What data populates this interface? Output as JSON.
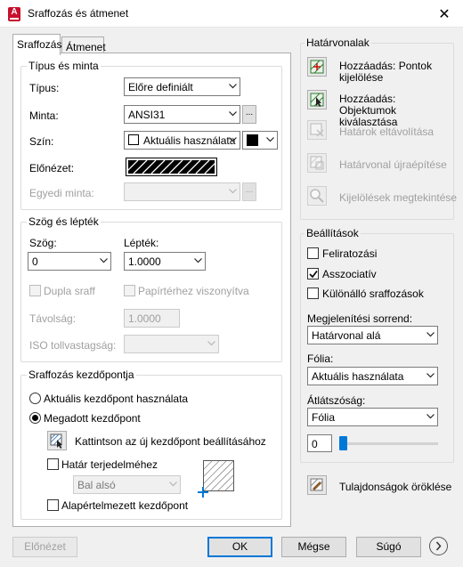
{
  "window": {
    "title": "Sraffozás és átmenet",
    "close_glyph": "✕"
  },
  "tabs": [
    {
      "label": "Sraffozás"
    },
    {
      "label": "Átmenet"
    }
  ],
  "type_pattern": {
    "group_title": "Típus és minta",
    "type_label": "Típus:",
    "type_value": "Előre definiált",
    "pattern_label": "Minta:",
    "pattern_value": "ANSI31",
    "color_label": "Szín:",
    "color_value": "Aktuális használata",
    "preview_label": "Előnézet:",
    "custom_label": "Egyedi minta:",
    "ellipsis": "..."
  },
  "angle_scale": {
    "group_title": "Szög és lépték",
    "angle_label": "Szög:",
    "angle_value": "0",
    "scale_label": "Lépték:",
    "scale_value": "1.0000",
    "double_label": "Dupla sraff",
    "paper_label": "Papírtérhez viszonyítva",
    "spacing_label": "Távolság:",
    "spacing_value": "1.0000",
    "iso_label": "ISO tollvastagság:"
  },
  "origin": {
    "group_title": "Sraffozás kezdőpontja",
    "current_label": "Aktuális kezdőpont használata",
    "specified_label": "Megadott kezdőpont",
    "click_label": "Kattintson az új kezdőpont beállításához",
    "extent_label": "Határ terjedelméhez",
    "extent_value": "Bal alsó",
    "default_label": "Alapértelmezett kezdőpont"
  },
  "boundaries": {
    "group_title": "Határvonalak",
    "add_points": "Hozzáadás: Pontok kijelölése",
    "add_objects": "Hozzáadás: Objektumok kiválasztása",
    "remove": "Határok eltávolítása",
    "recreate": "Határvonal újraépítése",
    "view": "Kijelölések megtekintése"
  },
  "options": {
    "group_title": "Beállítások",
    "annotative": "Feliratozási",
    "associative": "Asszociatív",
    "separate": "Különálló sraffozások",
    "draw_order_label": "Megjelenítési sorrend:",
    "draw_order_value": "Határvonal alá",
    "layer_label": "Fólia:",
    "layer_value": "Aktuális használata",
    "transparency_label": "Átlátszóság:",
    "transparency_value": "Fólia",
    "transparency_number": "0"
  },
  "inherit": "Tulajdonságok öröklése",
  "footer": {
    "preview": "Előnézet",
    "ok": "OK",
    "cancel": "Mégse",
    "help": "Súgó"
  },
  "colors": {
    "accent": "#0078d7",
    "app_red": "#c8102e"
  }
}
